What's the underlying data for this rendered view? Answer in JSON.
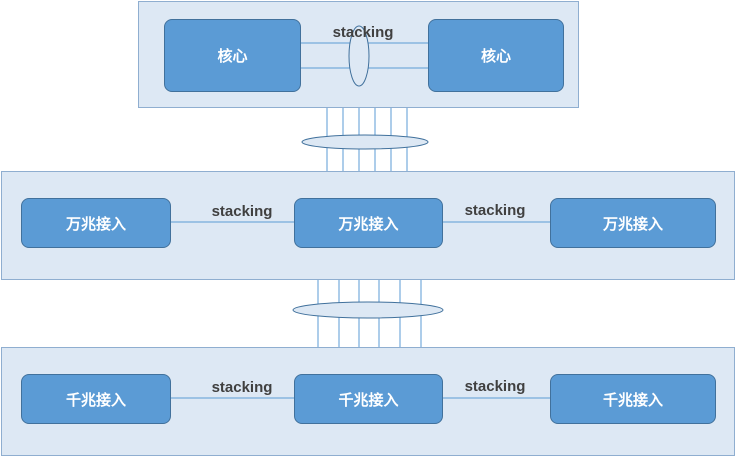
{
  "diagram": {
    "core": {
      "left_label": "核心",
      "right_label": "核心",
      "stacking_label": "stacking"
    },
    "tenG": {
      "nodes": [
        "万兆接入",
        "万兆接入",
        "万兆接入"
      ],
      "stacking_labels": [
        "stacking",
        "stacking"
      ]
    },
    "gig": {
      "nodes": [
        "千兆接入",
        "千兆接入",
        "千兆接入"
      ],
      "stacking_labels": [
        "stacking",
        "stacking"
      ]
    },
    "colors": {
      "panel_fill": "#dde8f4",
      "panel_border": "#8faed0",
      "node_fill": "#5b9bd5",
      "node_border": "#41719c",
      "link": "#5b9bd5",
      "label_text": "#404040"
    }
  }
}
